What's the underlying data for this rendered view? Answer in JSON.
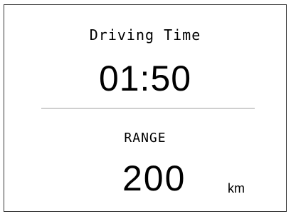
{
  "driving_time": {
    "label": "Driving Time",
    "value": "01:50"
  },
  "range": {
    "label": "RANGE",
    "value": "200",
    "unit": "km"
  }
}
